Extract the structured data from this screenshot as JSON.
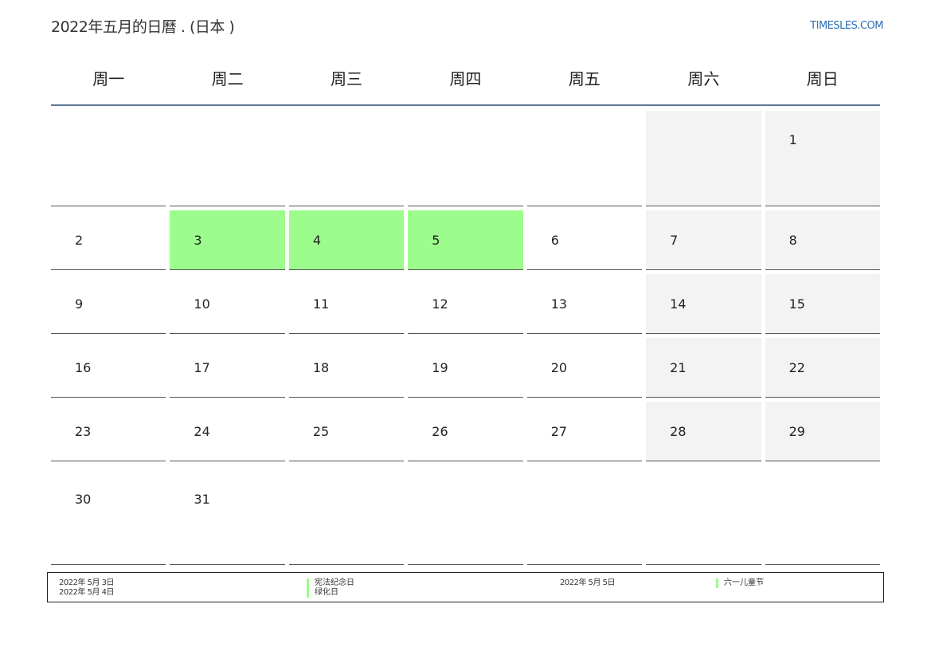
{
  "header": {
    "title": "2022年五月的日曆 . (日本 )",
    "site": "TIMESLES.COM"
  },
  "calendar": {
    "weekdays": [
      "周一",
      "周二",
      "周三",
      "周四",
      "周五",
      "周六",
      "周日"
    ],
    "weeks": [
      [
        "",
        "",
        "",
        "",
        "",
        "",
        "1"
      ],
      [
        "2",
        "3",
        "4",
        "5",
        "6",
        "7",
        "8"
      ],
      [
        "9",
        "10",
        "11",
        "12",
        "13",
        "14",
        "15"
      ],
      [
        "16",
        "17",
        "18",
        "19",
        "20",
        "21",
        "22"
      ],
      [
        "23",
        "24",
        "25",
        "26",
        "27",
        "28",
        "29"
      ],
      [
        "30",
        "31",
        "",
        "",
        "",
        "",
        ""
      ]
    ],
    "holiday_days": [
      "3",
      "4",
      "5"
    ],
    "colors": {
      "holiday": "#9cfc8c",
      "weekend": "#f3f3f3",
      "header_rule": "#5d7695",
      "link": "#2a6fb5"
    }
  },
  "legend": {
    "holidays": [
      {
        "date": "2022年 5月 3日",
        "name": "宪法纪念日"
      },
      {
        "date": "2022年 5月 4日",
        "name": "绿化日"
      },
      {
        "date": "2022年 5月 5日",
        "name": "六一儿童节"
      }
    ]
  }
}
